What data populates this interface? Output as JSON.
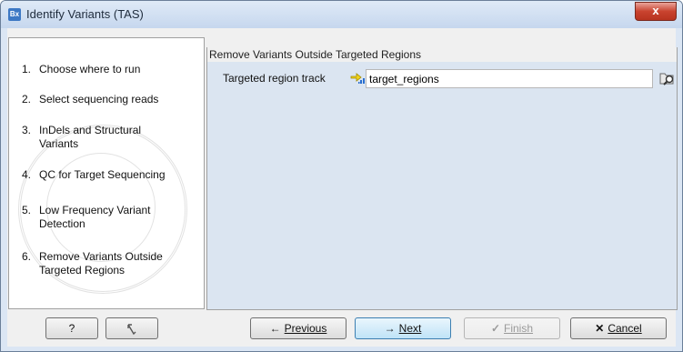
{
  "window": {
    "title": "Identify Variants (TAS)",
    "app_icon_text": "Bx",
    "close_glyph": "x"
  },
  "steps": [
    {
      "num": "1.",
      "label": "Choose where to run"
    },
    {
      "num": "2.",
      "label": "Select sequencing reads"
    },
    {
      "num": "3.",
      "label": "InDels and Structural Variants"
    },
    {
      "num": "4.",
      "label": "QC for Target Sequencing"
    },
    {
      "num": "5.",
      "label": "Low Frequency Variant Detection"
    },
    {
      "num": "6.",
      "label": "Remove Variants Outside Targeted Regions"
    }
  ],
  "panel": {
    "header": "Remove Variants Outside Targeted Regions",
    "field_label": "Targeted region track",
    "field_value": "target_regions",
    "track_icon": "track-icon",
    "browse_icon": "browse-icon"
  },
  "buttons": {
    "help_label": "?",
    "reset_icon": "reset-icon",
    "previous": {
      "arrow": "←",
      "label": "Previous"
    },
    "next": {
      "arrow": "→",
      "label": "Next"
    },
    "finish": {
      "mark": "✓",
      "label": "Finish"
    },
    "cancel": {
      "mark": "✕",
      "label": "Cancel"
    }
  },
  "colors": {
    "window_frame": "#dbe6f4",
    "panel_bg": "#dbe5f1",
    "close_red": "#c9432f",
    "default_button": "#bfe3f7"
  }
}
